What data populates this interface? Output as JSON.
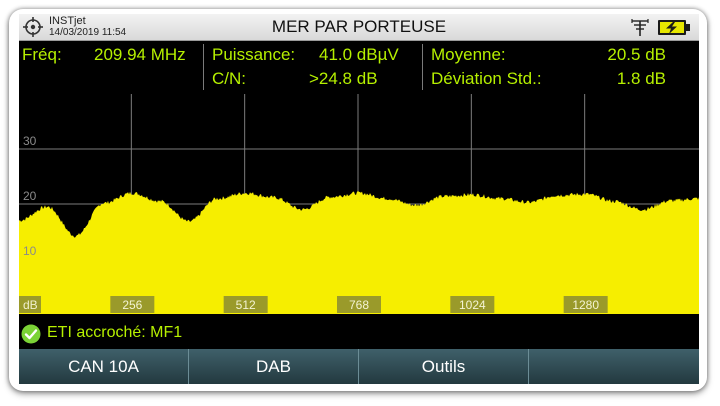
{
  "header": {
    "brand_name": "INSTjet",
    "datetime": "14/03/2019 11:54",
    "title": "MER PAR PORTEUSE"
  },
  "measurements": {
    "freq_label": "Fréq:",
    "freq_value": "209.94 MHz",
    "power_label": "Puissance:",
    "power_value": "41.0 dBµV",
    "cn_label": "C/N:",
    "cn_value": ">24.8 dB",
    "mean_label": "Moyenne:",
    "mean_value": "20.5 dB",
    "dev_label": "Déviation Std.:",
    "dev_value": "1.8 dB"
  },
  "status": {
    "text": "ETI accroché: MF1",
    "icon": "check-icon"
  },
  "softkeys": [
    "CAN 10A",
    "DAB",
    "Outils",
    ""
  ],
  "icons": {
    "brand": "crosshair-icon",
    "signal": "antenna-icon",
    "battery": "battery-charging-icon"
  },
  "colors": {
    "trace": "#f6ee00",
    "measure_text": "#b6f000",
    "background": "#000000",
    "grid": "#7d7d7d"
  },
  "chart_data": {
    "type": "area",
    "title": "",
    "xlabel": "",
    "ylabel": "dB",
    "x_ticks": [
      "256",
      "512",
      "768",
      "1024",
      "1280"
    ],
    "y_ticks": [
      "10",
      "20",
      "30"
    ],
    "xlim": [
      0,
      1536
    ],
    "ylim": [
      0,
      40
    ],
    "grid": true,
    "series": [
      {
        "x": [
          0,
          64,
          128,
          192,
          256,
          320,
          384,
          448,
          512,
          576,
          640,
          704,
          768,
          832,
          896,
          960,
          1024,
          1088,
          1152,
          1216,
          1280,
          1344,
          1408,
          1472,
          1536
        ],
        "values": [
          17,
          19.5,
          14.2,
          20.2,
          22,
          20.5,
          16.8,
          21,
          22,
          21.2,
          19,
          21.3,
          22,
          21,
          19.8,
          21.4,
          21.7,
          21,
          20.3,
          21.6,
          21.8,
          20.5,
          19,
          20.6,
          21
        ]
      }
    ]
  }
}
